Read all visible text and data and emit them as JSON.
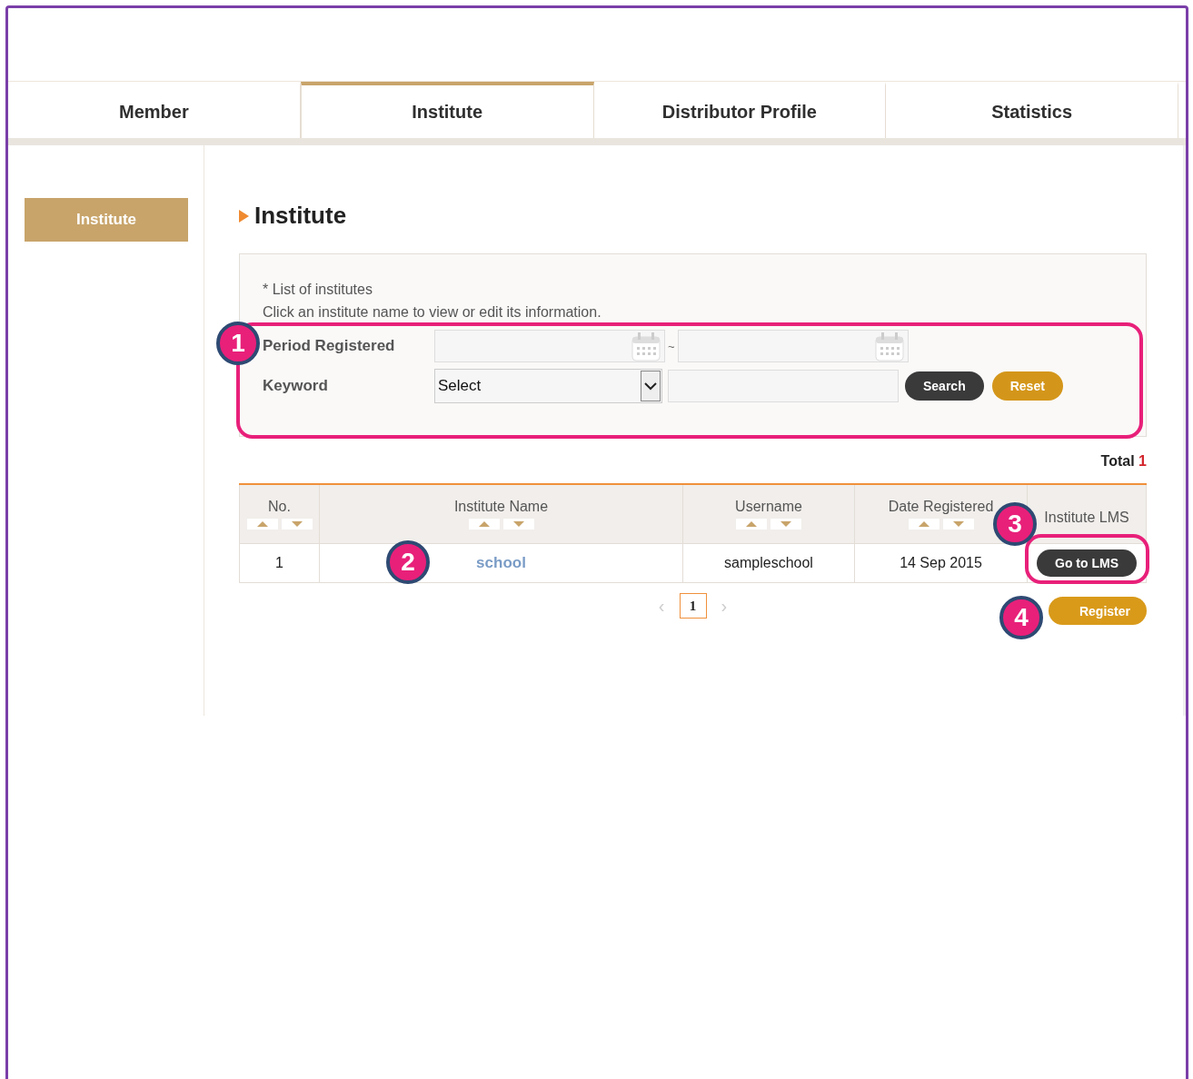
{
  "tabs": [
    {
      "label": "Member",
      "selected": false
    },
    {
      "label": "Institute",
      "selected": true
    },
    {
      "label": "Distributor Profile",
      "selected": false
    },
    {
      "label": "Statistics",
      "selected": false
    }
  ],
  "sidebar": {
    "items": [
      {
        "label": "Institute",
        "selected": true
      }
    ]
  },
  "page_title": "Institute",
  "notes": [
    "* List of institutes",
    "Click an institute name to view or edit its information."
  ],
  "search": {
    "period_label": "Period Registered",
    "separator": "~",
    "keyword_label": "Keyword",
    "keyword_select": "Select",
    "search_button": "Search",
    "reset_button": "Reset"
  },
  "total": {
    "label": "Total",
    "count": "1"
  },
  "table": {
    "columns": [
      {
        "label": "No.",
        "sortable": true
      },
      {
        "label": "Institute Name",
        "sortable": true
      },
      {
        "label": "Username",
        "sortable": true
      },
      {
        "label": "Date Registered",
        "sortable": true
      },
      {
        "label": "Institute LMS",
        "sortable": false
      }
    ],
    "rows": [
      {
        "no": "1",
        "name": "school",
        "username": "sampleschool",
        "date": "14 Sep 2015",
        "action": "Go to LMS"
      }
    ]
  },
  "pagination": {
    "prev": "‹",
    "pages": [
      {
        "label": "1",
        "selected": true
      }
    ],
    "next": "›"
  },
  "register_button": "Register",
  "annotations": [
    {
      "number": "1"
    },
    {
      "number": "2"
    },
    {
      "number": "3"
    },
    {
      "number": "4"
    }
  ]
}
